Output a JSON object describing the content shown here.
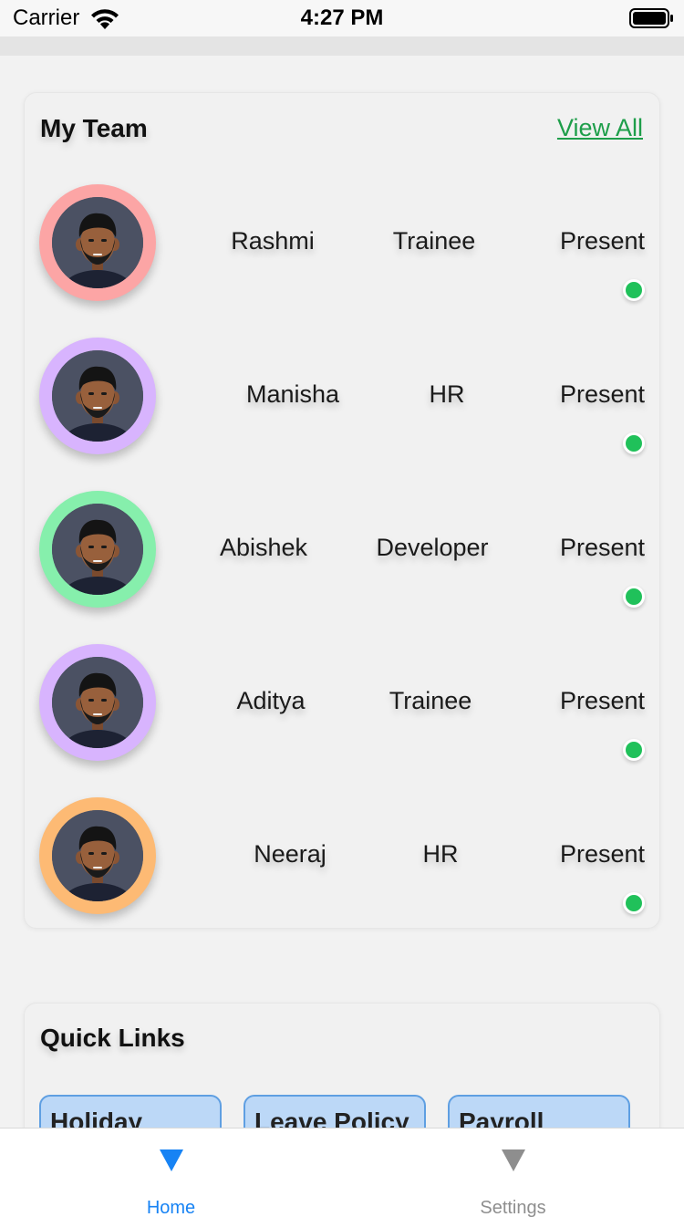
{
  "status_bar": {
    "carrier": "Carrier",
    "time": "4:27 PM"
  },
  "team": {
    "title": "My Team",
    "view_all": "View All",
    "members": [
      {
        "name": "Rashmi",
        "role": "Trainee",
        "status": "Present",
        "ring_color": "#fca5a5"
      },
      {
        "name": "Manisha",
        "role": "HR",
        "status": "Present",
        "ring_color": "#d8b4fe"
      },
      {
        "name": "Abishek",
        "role": "Developer",
        "status": "Present",
        "ring_color": "#86efac"
      },
      {
        "name": "Aditya",
        "role": "Trainee",
        "status": "Present",
        "ring_color": "#d8b4fe"
      },
      {
        "name": "Neeraj",
        "role": "HR",
        "status": "Present",
        "ring_color": "#fdba74"
      }
    ]
  },
  "quick_links": {
    "title": "Quick Links",
    "items": [
      {
        "label": "Holiday"
      },
      {
        "label": "Leave Policy"
      },
      {
        "label": "Payroll"
      }
    ]
  },
  "tabs": [
    {
      "label": "Home",
      "active": true,
      "icon": "triangle-down-icon",
      "color": "#1783f4"
    },
    {
      "label": "Settings",
      "active": false,
      "icon": "triangle-down-icon",
      "color": "#8e8e8e"
    }
  ],
  "colors": {
    "accent": "#1783f4",
    "link_green": "#1e9e4a",
    "present_dot": "#20c15a"
  }
}
